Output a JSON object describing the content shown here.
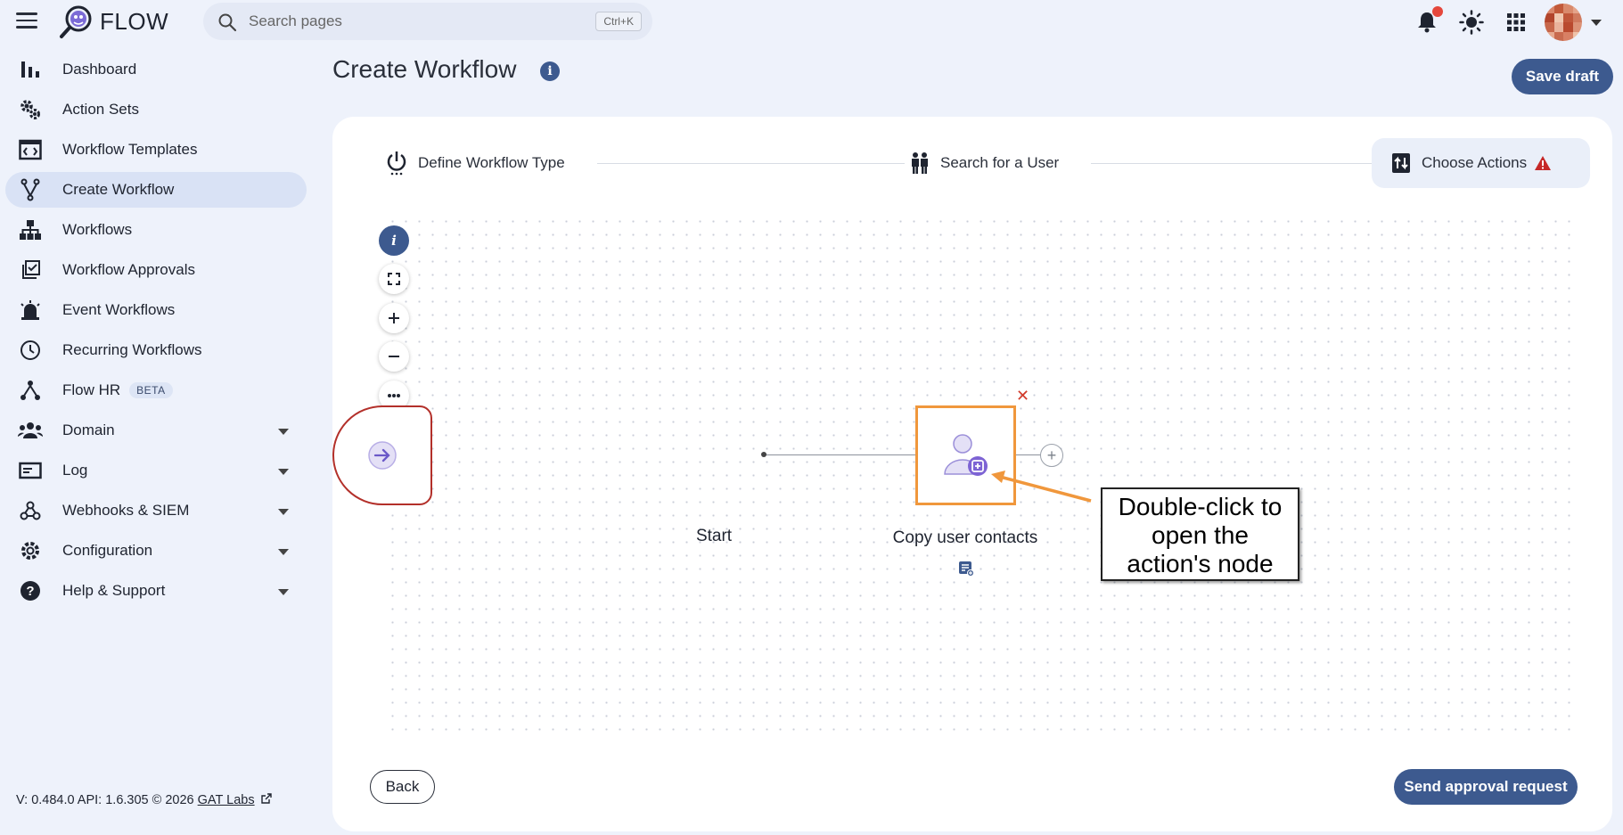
{
  "app": {
    "name": "FLOW"
  },
  "search": {
    "placeholder": "Search pages",
    "shortcut": "Ctrl+K"
  },
  "sidebar": {
    "items": [
      {
        "label": "Dashboard",
        "icon": "bar-chart-icon"
      },
      {
        "label": "Action Sets",
        "icon": "gears-icon"
      },
      {
        "label": "Workflow Templates",
        "icon": "template-icon"
      },
      {
        "label": "Create Workflow",
        "icon": "fork-icon",
        "active": true
      },
      {
        "label": "Workflows",
        "icon": "hierarchy-icon"
      },
      {
        "label": "Workflow Approvals",
        "icon": "approval-icon"
      },
      {
        "label": "Event Workflows",
        "icon": "siren-icon"
      },
      {
        "label": "Recurring Workflows",
        "icon": "clock-icon"
      },
      {
        "label": "Flow HR",
        "icon": "people-tree-icon",
        "badge": "BETA"
      },
      {
        "label": "Domain",
        "icon": "group-icon",
        "expandable": true
      },
      {
        "label": "Log",
        "icon": "log-icon",
        "expandable": true
      },
      {
        "label": "Webhooks & SIEM",
        "icon": "webhook-icon",
        "expandable": true
      },
      {
        "label": "Configuration",
        "icon": "gear-icon",
        "expandable": true
      },
      {
        "label": "Help & Support",
        "icon": "help-icon",
        "expandable": true
      }
    ],
    "version_text": "V: 0.484.0  API: 1.6.305  © 2026",
    "company_link": "GAT Labs"
  },
  "page": {
    "title": "Create Workflow",
    "save_draft": "Save draft"
  },
  "steps": [
    {
      "label": "Define Workflow Type"
    },
    {
      "label": "Search for a User"
    },
    {
      "label": "Choose Actions"
    }
  ],
  "canvas": {
    "start_label": "Start",
    "action_label": "Copy user contacts",
    "callout_lines": [
      "Double-click to",
      "open the",
      "action's node"
    ]
  },
  "footer": {
    "back": "Back",
    "send": "Send approval request"
  },
  "colors": {
    "primary": "#3d5a8f",
    "start_border": "#b3302a",
    "highlight": "#f0973c",
    "warning": "#c62828"
  }
}
